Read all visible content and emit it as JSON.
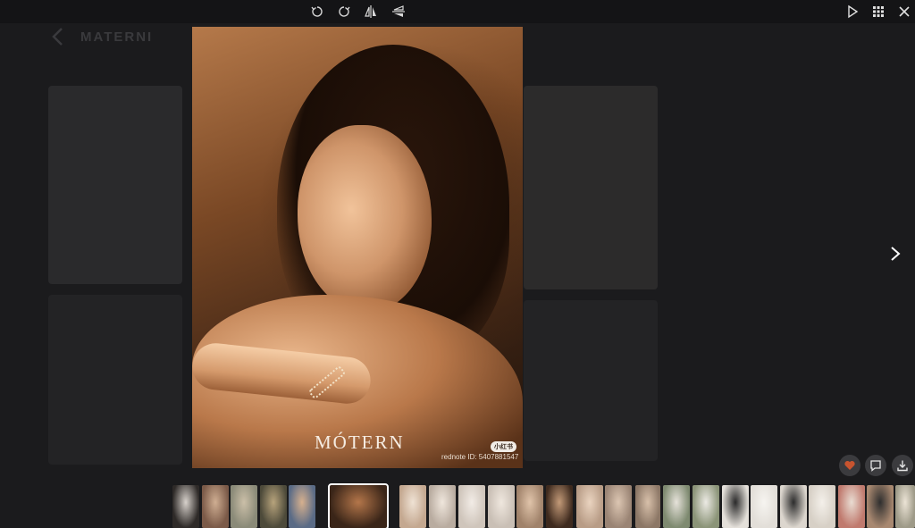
{
  "background_page": {
    "title": "MATERNI"
  },
  "toolbar": {
    "icons": [
      "rotate-left-icon",
      "rotate-right-icon",
      "flip-horizontal-icon",
      "flip-vertical-icon",
      "play-icon",
      "grid-icon",
      "close-icon"
    ]
  },
  "main_image": {
    "brand_logo": "MÓTERN",
    "badge": "小红书",
    "watermark": "rednote ID: 5407881547"
  },
  "actions": [
    "heart-icon",
    "comment-icon",
    "download-icon"
  ],
  "colors": {
    "background": "#1b1b1d",
    "toolbar": "#141416",
    "heart": "#c8542f",
    "thumb_light": "#d9d2c8",
    "thumb_warm": "#8a5a3a"
  },
  "thumbnails": [
    {
      "tone": "#2e2a28",
      "accent": "#d8d2cc"
    },
    {
      "tone": "#7b5a48",
      "accent": "#cfae92"
    },
    {
      "tone": "#8a8a78",
      "accent": "#cbbfa8"
    },
    {
      "tone": "#4d4a3a",
      "accent": "#b7a37c"
    },
    {
      "tone": "#5a6b86",
      "accent": "#d6b08e"
    },
    {
      "tone": "#3a2518",
      "accent": "#b4764a"
    },
    {
      "tone": "#c4a890",
      "accent": "#efe2d4"
    },
    {
      "tone": "#b9aca0",
      "accent": "#efe6dc"
    },
    {
      "tone": "#cfc5bb",
      "accent": "#f2ece6"
    },
    {
      "tone": "#c9bfb5",
      "accent": "#efe7de"
    },
    {
      "tone": "#a0826a",
      "accent": "#e0c4aa"
    },
    {
      "tone": "#3e2a1e",
      "accent": "#c39a78"
    },
    {
      "tone": "#b89c86",
      "accent": "#ead4c0"
    },
    {
      "tone": "#9a8474",
      "accent": "#dcc6b2"
    },
    {
      "tone": "#8c7766",
      "accent": "#d8c0aa"
    },
    {
      "tone": "#7e8a70",
      "accent": "#e6e2da"
    },
    {
      "tone": "#8b9478",
      "accent": "#eceae4"
    },
    {
      "tone": "#e4e0da",
      "accent": "#2a2a2a"
    },
    {
      "tone": "#e2ded8",
      "accent": "#f6f4f0"
    },
    {
      "tone": "#dcd6ce",
      "accent": "#2c2c2c"
    },
    {
      "tone": "#d7d0c6",
      "accent": "#f4f0ea"
    },
    {
      "tone": "#c07a6e",
      "accent": "#e9dcd2"
    },
    {
      "tone": "#a88870",
      "accent": "#2e2e2e"
    },
    {
      "tone": "#9e9a88",
      "accent": "#ece4d6"
    }
  ]
}
